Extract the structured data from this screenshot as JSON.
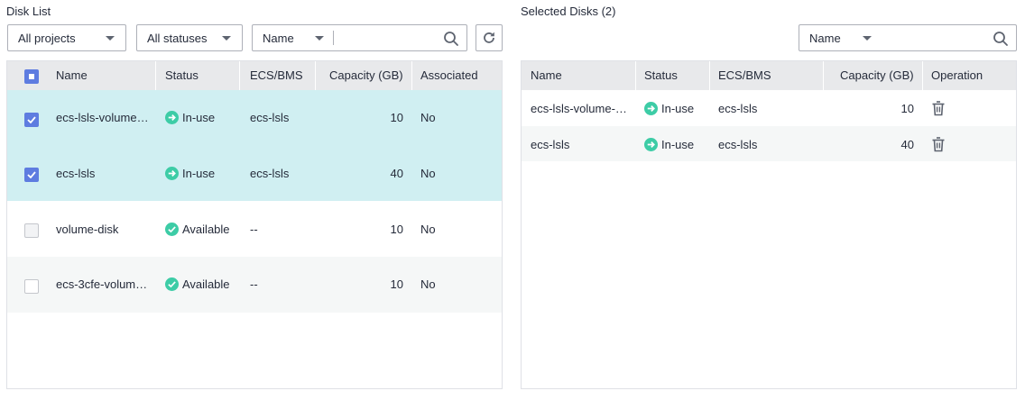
{
  "left_panel": {
    "title": "Disk List",
    "project_filter": "All projects",
    "status_filter": "All statuses",
    "search_field": "Name",
    "search_value": "",
    "columns": [
      "Name",
      "Status",
      "ECS/BMS",
      "Capacity (GB)",
      "Associated"
    ],
    "rows": [
      {
        "name": "ecs-lsls-volume…",
        "status": "In-use",
        "ecs": "ecs-lsls",
        "capacity": "10",
        "associated": "No",
        "checked": true
      },
      {
        "name": "ecs-lsls",
        "status": "In-use",
        "ecs": "ecs-lsls",
        "capacity": "40",
        "associated": "No",
        "checked": true
      },
      {
        "name": "volume-disk",
        "status": "Available",
        "ecs": "--",
        "capacity": "10",
        "associated": "No",
        "checked": false
      },
      {
        "name": "ecs-3cfe-volum…",
        "status": "Available",
        "ecs": "--",
        "capacity": "10",
        "associated": "No",
        "checked": false
      }
    ]
  },
  "right_panel": {
    "title": "Selected Disks (2)",
    "search_field": "Name",
    "search_value": "",
    "columns": [
      "Name",
      "Status",
      "ECS/BMS",
      "Capacity (GB)",
      "Operation"
    ],
    "rows": [
      {
        "name": "ecs-lsls-volume-…",
        "status": "In-use",
        "ecs": "ecs-lsls",
        "capacity": "10"
      },
      {
        "name": "ecs-lsls",
        "status": "In-use",
        "ecs": "ecs-lsls",
        "capacity": "40"
      }
    ]
  },
  "colors": {
    "accent": "#5e7ce0",
    "selected_row": "#d0eff2",
    "stripe_row": "#f5f7f7",
    "status_green": "#3dcca6",
    "header_bg": "#e8e9eb"
  },
  "icons": {
    "in_use": "arrow-circle-icon",
    "available": "check-circle-icon",
    "search": "search-icon",
    "refresh": "refresh-icon",
    "delete": "trash-icon"
  }
}
